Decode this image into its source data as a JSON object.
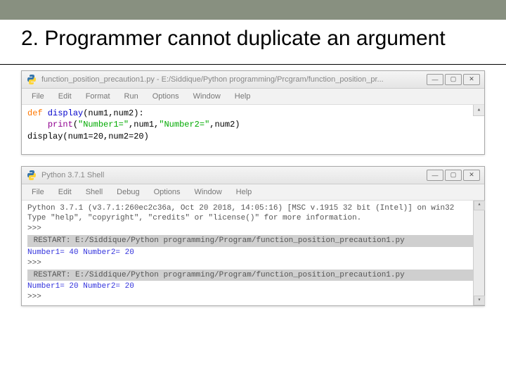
{
  "slide": {
    "title": "2. Programmer cannot duplicate an argument"
  },
  "editor_window": {
    "title": "function_position_precaution1.py - E:/Siddique/Python programming/Prcgram/function_position_pr...",
    "menu": [
      "File",
      "Edit",
      "Format",
      "Run",
      "Options",
      "Window",
      "Help"
    ],
    "code": {
      "def_kw": "def",
      "fn_name": " display",
      "params": "(num1,num2)",
      "colon": ":",
      "indent": "    ",
      "print_kw": "print",
      "print_args_open": "(",
      "str1": "\"Number1=\"",
      "comma1": ",num1,",
      "str2": "\"Number2=\"",
      "comma2": ",num2)",
      "call_line": "display(num1=20,num2=20)"
    }
  },
  "shell_window": {
    "title": "Python 3.7.1 Shell",
    "menu": [
      "File",
      "Edit",
      "Shell",
      "Debug",
      "Options",
      "Window",
      "Help"
    ],
    "banner1": "Python 3.7.1 (v3.7.1:260ec2c36a, Oct 20 2018, 14:05:16) [MSC v.1915 32 bit (Intel)] on win32",
    "banner2": "Type \"help\", \"copyright\", \"credits\" or \"license()\" for more information.",
    "prompt": ">>> ",
    "restart1": " RESTART: E:/Siddique/Python programming/Program/function_position_precaution1.py ",
    "output1": "Number1= 40 Number2= 20",
    "restart2": " RESTART: E:/Siddique/Python programming/Program/function_position_precaution1.py ",
    "output2": "Number1= 20 Number2= 20"
  },
  "win_buttons": {
    "min": "—",
    "max": "▢",
    "close": "✕"
  }
}
